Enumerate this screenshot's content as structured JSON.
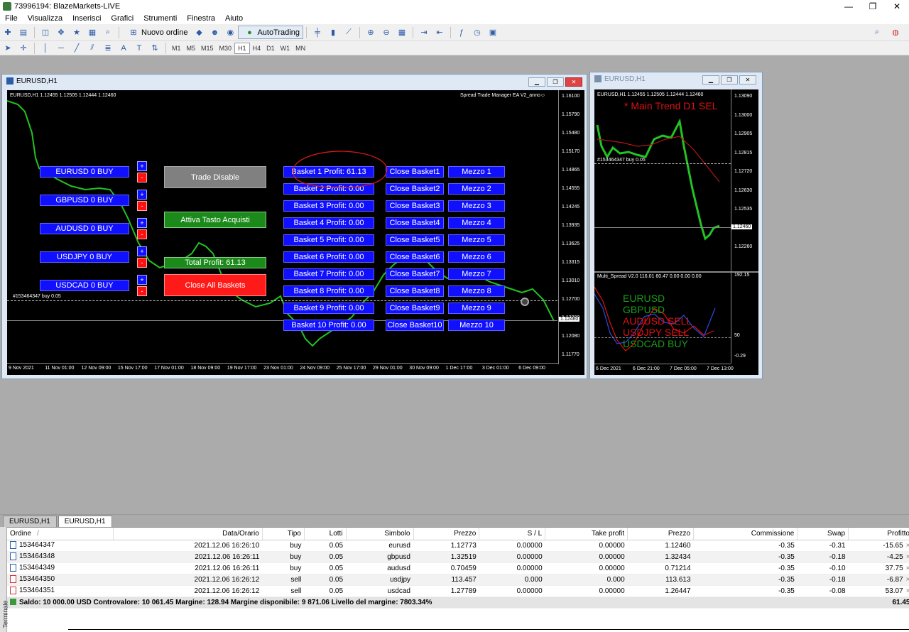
{
  "window": {
    "title": "73996194: BlazeMarkets-LIVE",
    "controls": [
      "—",
      "❐",
      "✕"
    ]
  },
  "menu": [
    "File",
    "Visualizza",
    "Inserisci",
    "Grafici",
    "Strumenti",
    "Finestra",
    "Aiuto"
  ],
  "toolbar": {
    "new_order": "Nuovo ordine",
    "autotrading": "AutoTrading"
  },
  "timeframes": [
    "M1",
    "M5",
    "M15",
    "M30",
    "H1",
    "H4",
    "D1",
    "W1",
    "MN"
  ],
  "timeframe_active": "H1",
  "main_chart": {
    "window_title": "EURUSD,H1",
    "header": "EURUSD,H1  1.12455 1.12505 1.12444 1.12460",
    "ea_label": "Spread Trade Manager EA V2_anno☺",
    "order_line_label": "#153464347 buy 0.05",
    "price_marker": "1.12460",
    "price_axis": [
      "1.16100",
      "1.15790",
      "1.15480",
      "1.15170",
      "1.14865",
      "1.14555",
      "1.14245",
      "1.13935",
      "1.13625",
      "1.13315",
      "1.13010",
      "1.12700",
      "1.12390",
      "1.12080",
      "1.11770"
    ],
    "time_axis": [
      "9 Nov 2021",
      "11 Nov 01:00",
      "12 Nov 09:00",
      "15 Nov 17:00",
      "17 Nov 01:00",
      "18 Nov 09:00",
      "19 Nov 17:00",
      "23 Nov 01:00",
      "24 Nov 09:00",
      "25 Nov 17:00",
      "29 Nov 01:00",
      "30 Nov 09:00",
      "1 Dec 17:00",
      "3 Dec 01:00",
      "6 Dec 09:00"
    ],
    "pair_buttons": [
      "EURUSD 0 BUY",
      "GBPUSD 0 BUY",
      "AUDUSD 0 BUY",
      "USDJPY 0 BUY",
      "USDCAD 0 BUY"
    ],
    "plus": "+",
    "minus": "-",
    "trade_disable": "Trade Disable",
    "attiva": "Attiva Tasto Acquisti",
    "total_profit": "Total Profit: 61.13",
    "close_all": "Close All Baskets",
    "baskets": [
      "Basket 1 Profit: 61.13",
      "Basket 2 Profit: 0.00",
      "Basket 3 Profit: 0.00",
      "Basket 4 Profit: 0.00",
      "Basket 5 Profit: 0.00",
      "Basket 6 Profit: 0.00",
      "Basket 7 Profit: 0.00",
      "Basket 8 Profit: 0.00",
      "Basket 9 Profit: 0.00",
      "Basket 10 Profit: 0.00"
    ],
    "close_baskets": [
      "Close Basket1",
      "Close Basket2",
      "Close Basket3",
      "Close Basket4",
      "Close Basket5",
      "Close Basket6",
      "Close Basket7",
      "Close Basket8",
      "Close Basket9",
      "Close Basket10"
    ],
    "mezzo": [
      "Mezzo 1",
      "Mezzo 2",
      "Mezzo 3",
      "Mezzo 4",
      "Mezzo 5",
      "Mezzo 6",
      "Mezzo 7",
      "Mezzo 8",
      "Mezzo 9",
      "Mezzo 10"
    ]
  },
  "side_chart": {
    "window_title": "EURUSD,H1",
    "header": "EURUSD,H1  1.12455 1.12505 1.12444 1.12460",
    "trend": "* Main Trend D1 SEL",
    "order_line_label": "#153464347 buy 0.05",
    "price_marker": "1.12460",
    "price_axis": [
      "1.13090",
      "1.13000",
      "1.12905",
      "1.12815",
      "1.12720",
      "1.12630",
      "1.12535",
      "1.12350",
      "1.12260"
    ],
    "indicator_header": "Multi_Spread V2.0  116.01 60.47 0.00 0.00 0.00",
    "indicator_axis": [
      "192.15",
      "50",
      "-0.29"
    ],
    "legend": [
      {
        "label": "EURUSD",
        "color": "#1a9c1a"
      },
      {
        "label": "GBPUSD",
        "color": "#1a9c1a"
      },
      {
        "label": "AUDUSD SELL",
        "color": "#e01010"
      },
      {
        "label": "USDJPY SELL",
        "color": "#e01010"
      },
      {
        "label": "USDCAD BUY",
        "color": "#1a9c1a"
      }
    ],
    "time_axis": [
      "6 Dec 2021",
      "6 Dec 21:00",
      "7 Dec 05:00",
      "7 Dec 13:00"
    ]
  },
  "terminal": {
    "tabs": [
      "EURUSD,H1",
      "EURUSD,H1"
    ],
    "side_label": "Terminale",
    "columns": [
      "Ordine",
      "Data/Orario",
      "Tipo",
      "Lotti",
      "Simbolo",
      "Prezzo",
      "S / L",
      "Take profit",
      "Prezzo",
      "Commissione",
      "Swap",
      "Profitto"
    ],
    "sort_marker": "/",
    "rows": [
      [
        "153464347",
        "2021.12.06 16:26:10",
        "buy",
        "0.05",
        "eurusd",
        "1.12773",
        "0.00000",
        "0.00000",
        "1.12460",
        "-0.35",
        "-0.31",
        "-15.65"
      ],
      [
        "153464348",
        "2021.12.06 16:26:11",
        "buy",
        "0.05",
        "gbpusd",
        "1.32519",
        "0.00000",
        "0.00000",
        "1.32434",
        "-0.35",
        "-0.18",
        "-4.25"
      ],
      [
        "153464349",
        "2021.12.06 16:26:11",
        "buy",
        "0.05",
        "audusd",
        "0.70459",
        "0.00000",
        "0.00000",
        "0.71214",
        "-0.35",
        "-0.10",
        "37.75"
      ],
      [
        "153464350",
        "2021.12.06 16:26:12",
        "sell",
        "0.05",
        "usdjpy",
        "113.457",
        "0.000",
        "0.000",
        "113.613",
        "-0.35",
        "-0.18",
        "-6.87"
      ],
      [
        "153464351",
        "2021.12.06 16:26:12",
        "sell",
        "0.05",
        "usdcad",
        "1.27789",
        "0.00000",
        "0.00000",
        "1.26447",
        "-0.35",
        "-0.08",
        "53.07"
      ]
    ],
    "row_close": "×",
    "summary": "Saldo: 10 000.00 USD  Controvalore: 10 061.45  Margine: 128.94  Margine disponibile: 9 871.06  Livello del margine: 7803.34%",
    "summary_total": "61.45"
  }
}
